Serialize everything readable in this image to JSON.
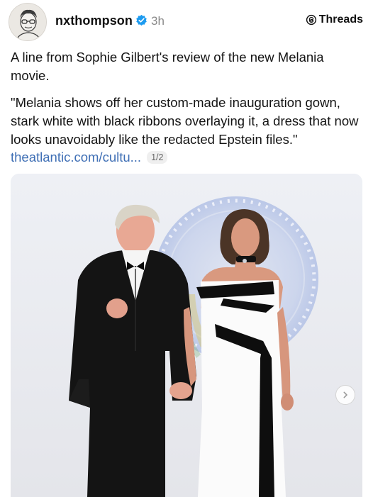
{
  "post": {
    "username": "nxthompson",
    "timestamp": "3h",
    "verified_icon": "verified-badge-icon",
    "app_label": "Threads",
    "paragraph_1": "A line from Sophie Gilbert's review of the new Melania movie.",
    "paragraph_2": "\"Melania shows off her custom-made inauguration gown, stark white with black ribbons overlaying it, a dress that now looks unavoidably like the redacted Epstein files.\"",
    "link_text": "theatlantic.com/cultu...",
    "media_counter": "1/2"
  },
  "colors": {
    "link": "#3f6fb5",
    "verified": "#1d9bf0",
    "muted": "#8a8a8a"
  }
}
